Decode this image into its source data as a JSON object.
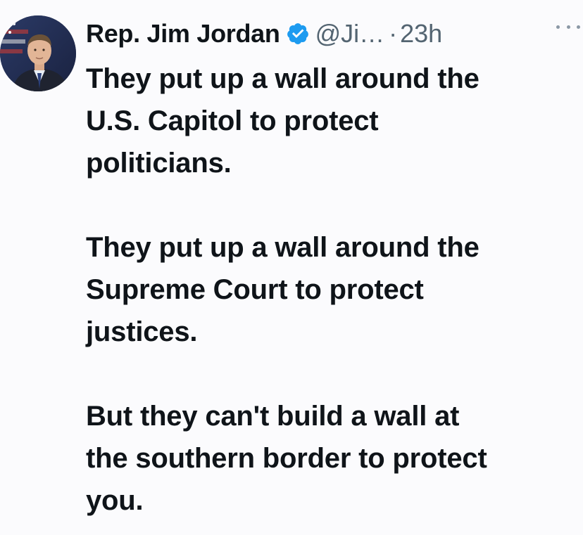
{
  "tweet": {
    "author_name": "Rep. Jim Jordan",
    "handle": "@Ji…",
    "separator": "·",
    "timestamp": "23h",
    "verified_icon": "verified-badge-icon",
    "more_icon": "more-options-icon",
    "accent_color": "#1d9bf0",
    "paragraphs": [
      [
        "They put up a wall around the",
        "U.S. Capitol to protect",
        "politicians."
      ],
      [
        "They put up a wall around the",
        "Supreme Court to protect",
        "justices."
      ],
      [
        "But they can't build a wall at",
        "the southern border to protect",
        "you."
      ]
    ]
  }
}
